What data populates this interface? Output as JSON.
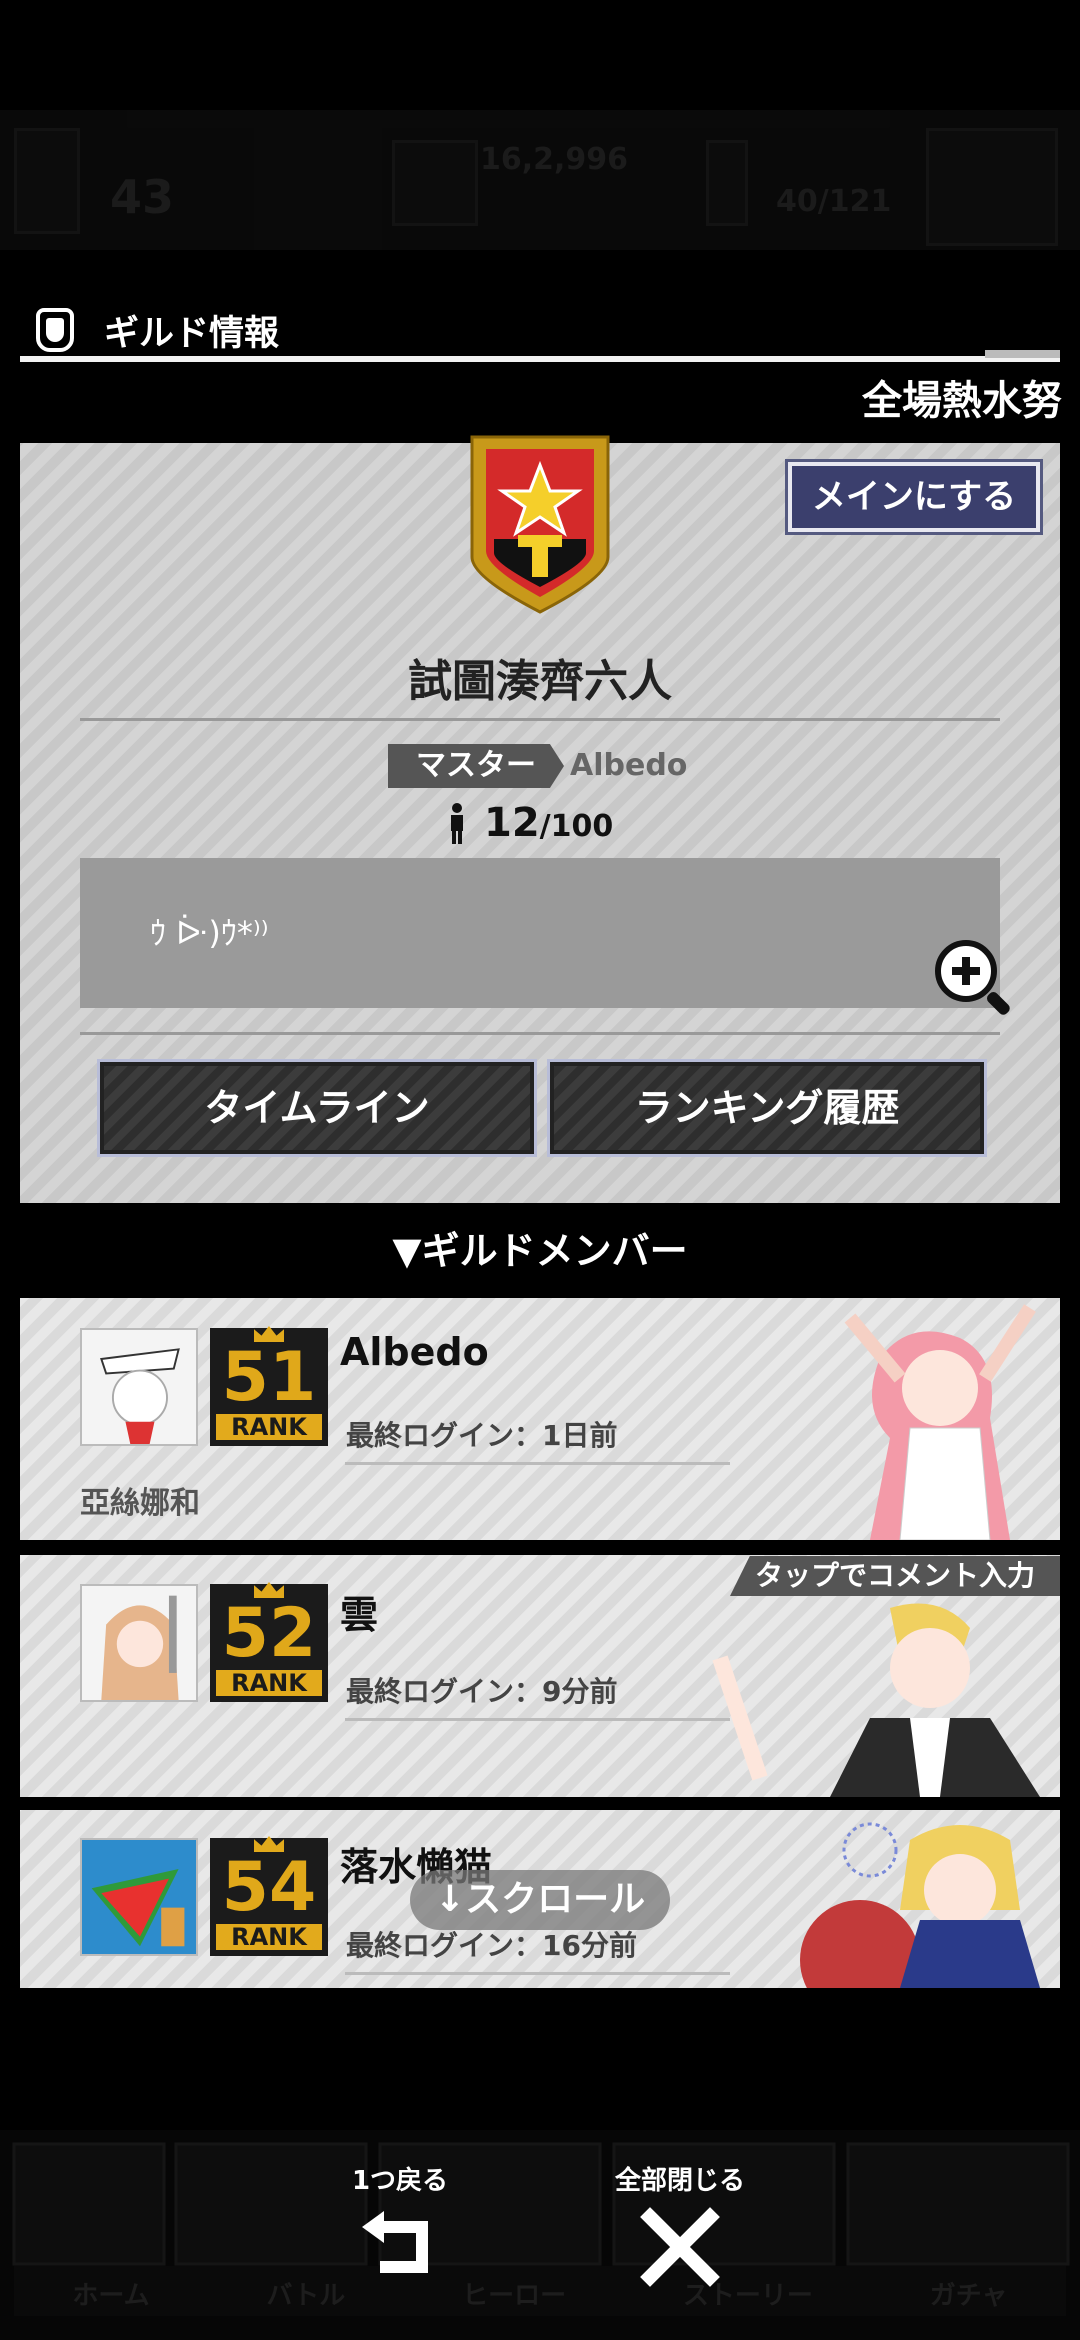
{
  "background_hud": {
    "level": "43",
    "exp": "16,2,996",
    "stamina": "40/121",
    "bottom_tabs": [
      "ホーム",
      "バトル",
      "ヒーロー",
      "ストーリー",
      "ガチャ"
    ]
  },
  "header": {
    "title": "ギルド情報",
    "ticker": "全場熱水努"
  },
  "guild": {
    "main_button": "メインにする",
    "name": "試圖湊齊六人",
    "master_label": "マスター",
    "master_name": "Albedo",
    "members_current": "12",
    "members_max": "/100",
    "comment": "ｳ ᐕ)ｳ*⁾⁾",
    "timeline_button": "タイムライン",
    "ranking_button": "ランキング履歴"
  },
  "members_section": {
    "title": "▼ギルドメンバー",
    "tap_hint": "タップでコメント入力",
    "scroll_hint": "↓スクロール",
    "members": [
      {
        "rank": "51",
        "rank_label": "RANK",
        "name": "Albedo",
        "last_login": "最終ログイン：1日前",
        "comment": "亞絲娜和"
      },
      {
        "rank": "52",
        "rank_label": "RANK",
        "name": "雲",
        "last_login": "最終ログイン：9分前",
        "comment": ""
      },
      {
        "rank": "54",
        "rank_label": "RANK",
        "name": "落水懶猫",
        "last_login": "最終ログイン：16分前",
        "comment": ""
      }
    ]
  },
  "bottom_nav": {
    "back_label": "1つ戻る",
    "close_all_label": "全部閉じる"
  },
  "colors": {
    "panel_button": "#3b3f6d",
    "rank_gold": "#e2aa1c",
    "emblem_red": "#d42a2a"
  }
}
